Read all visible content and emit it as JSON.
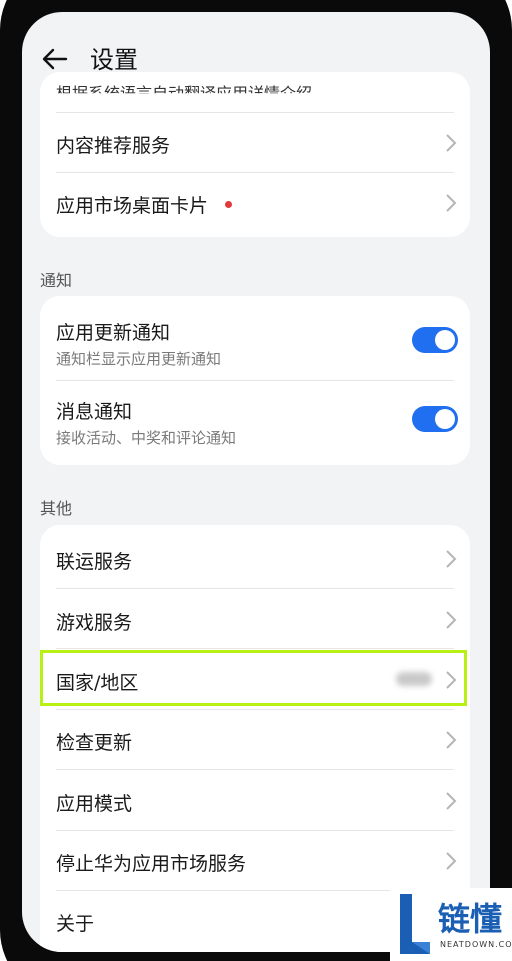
{
  "header": {
    "title": "设置"
  },
  "top_card": {
    "partial_text": "根据系统语言自动翻译应用详情介绍",
    "items": [
      {
        "label": "内容推荐服务"
      },
      {
        "label": "应用市场桌面卡片"
      }
    ]
  },
  "notification": {
    "section_title": "通知",
    "items": [
      {
        "label": "应用更新通知",
        "sub": "通知栏显示应用更新通知",
        "enabled": true
      },
      {
        "label": "消息通知",
        "sub": "接收活动、中奖和评论通知",
        "enabled": true
      }
    ]
  },
  "other": {
    "section_title": "其他",
    "items": [
      {
        "label": "联运服务"
      },
      {
        "label": "游戏服务"
      },
      {
        "label": "国家/地区"
      },
      {
        "label": "检查更新"
      },
      {
        "label": "应用模式"
      },
      {
        "label": "停止华为应用市场服务"
      },
      {
        "label": "关于"
      }
    ]
  },
  "watermark": {
    "text": "链懂",
    "site": "NEATDOWN.COM"
  },
  "colors": {
    "accent": "#1f6ff0",
    "highlight": "#b8f016",
    "dot": "#e03a3a"
  }
}
